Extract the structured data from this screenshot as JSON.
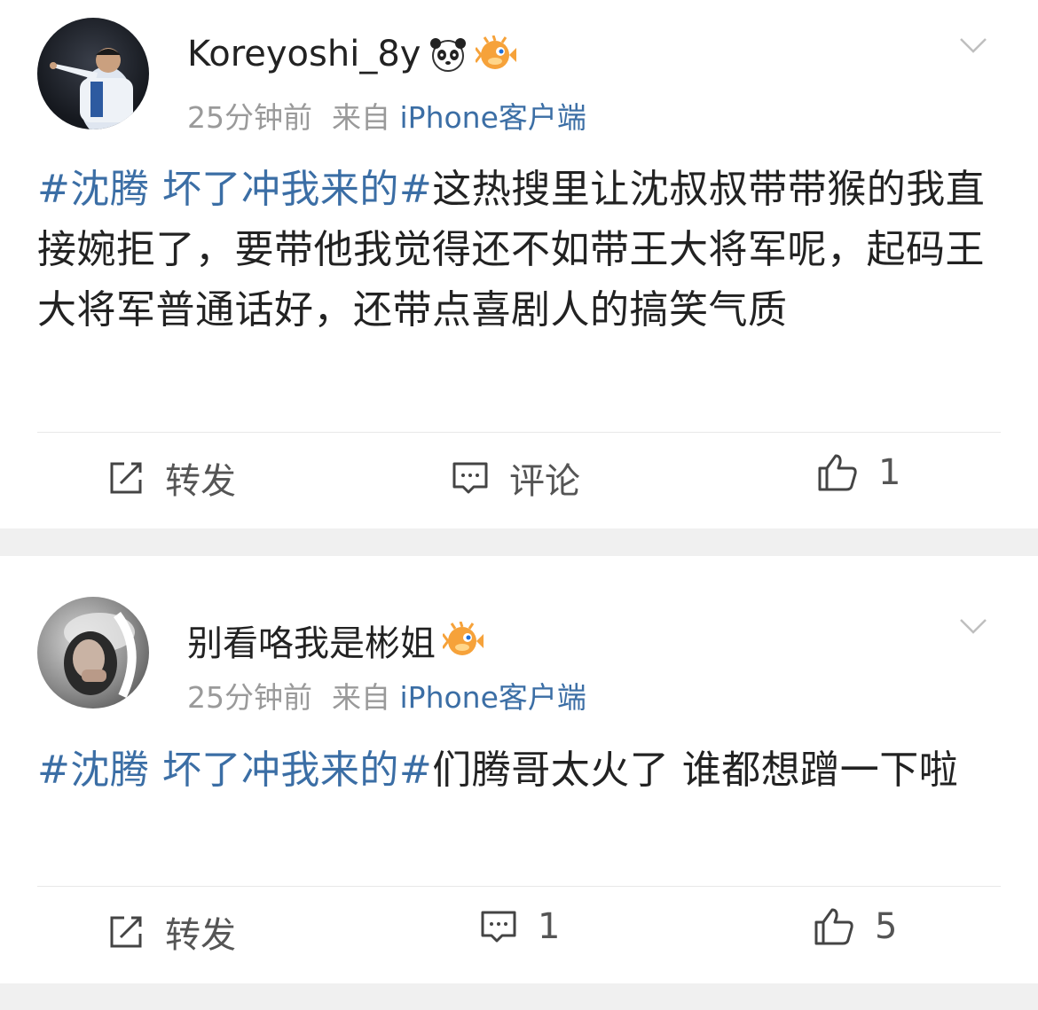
{
  "posts": [
    {
      "username": "Koreyoshi_8y",
      "badges": [
        "panda-icon",
        "pufferfish-icon"
      ],
      "time": "25分钟前",
      "source_prefix": "来自",
      "source": "iPhone客户端",
      "topic": "#沈腾 坏了冲我来的#",
      "text": "这热搜里让沈叔叔带带猴的我直接婉拒了，要带他我觉得还不如带王大将军呢，起码王大将军普通话好，还带点喜剧人的搞笑气质",
      "repost_label": "转发",
      "comment_label": "评论",
      "like_count": "1"
    },
    {
      "username": "别看咯我是彬姐",
      "badges": [
        "pufferfish-icon"
      ],
      "time": "25分钟前",
      "source_prefix": "来自",
      "source": "iPhone客户端",
      "topic": "#沈腾 坏了冲我来的#",
      "text": "们腾哥太火了 谁都想蹭一下啦",
      "repost_label": "转发",
      "comment_count": "1",
      "like_count": "5"
    }
  ],
  "colors": {
    "link": "#3b6ea5",
    "meta": "#9a9a9a",
    "text": "#222222",
    "separator": "#f0f0f0"
  }
}
